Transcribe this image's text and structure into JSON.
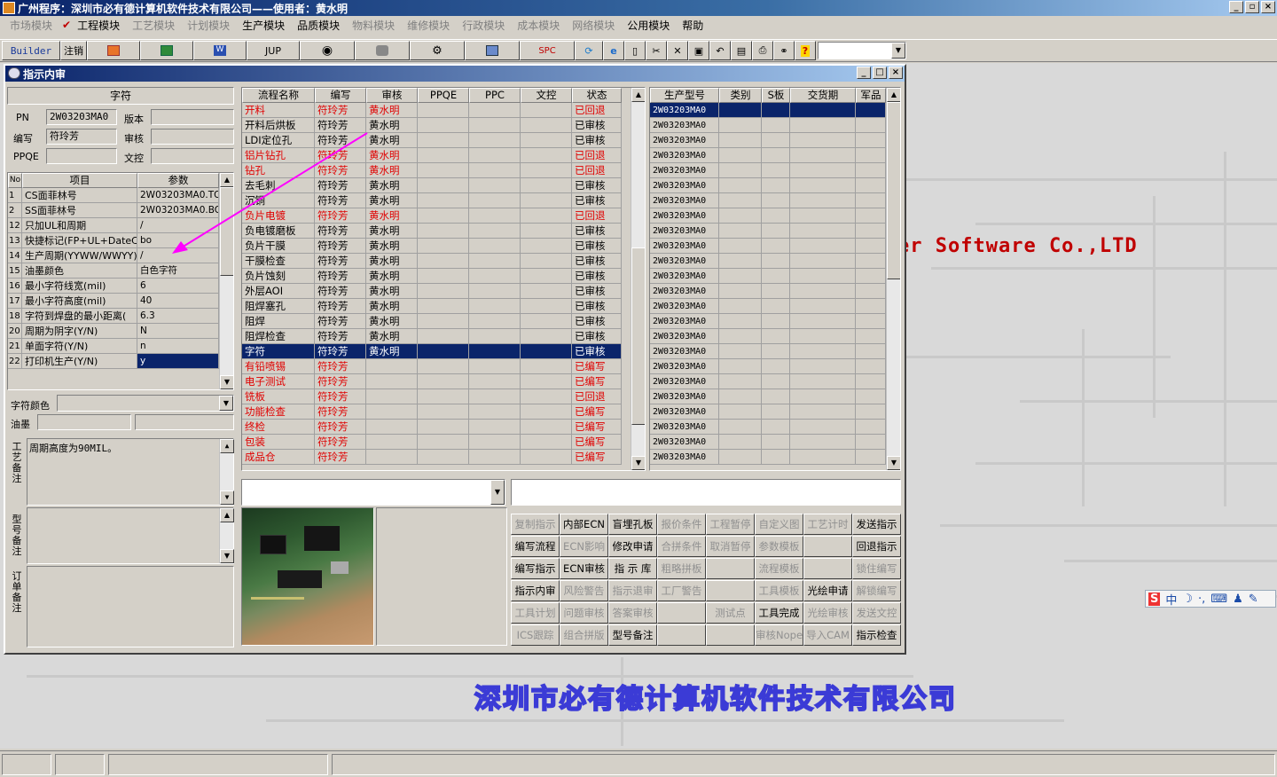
{
  "app": {
    "title": "广州程序：深圳市必有德计算机软件技术有限公司——使用者：黄水明",
    "menus": [
      {
        "label": "市场模块",
        "enabled": false
      },
      {
        "label": "工程模块",
        "enabled": true
      },
      {
        "label": "工艺模块",
        "enabled": false
      },
      {
        "label": "计划模块",
        "enabled": false
      },
      {
        "label": "生产模块",
        "enabled": true
      },
      {
        "label": "品质模块",
        "enabled": true
      },
      {
        "label": "物料模块",
        "enabled": false
      },
      {
        "label": "维修模块",
        "enabled": false
      },
      {
        "label": "行政模块",
        "enabled": false
      },
      {
        "label": "成本模块",
        "enabled": false
      },
      {
        "label": "网络模块",
        "enabled": false
      },
      {
        "label": "公用模块",
        "enabled": true
      },
      {
        "label": "帮助",
        "enabled": true
      }
    ],
    "toolbar": {
      "builder": "Builder",
      "logout": "注销",
      "jup": "JUP",
      "spc": "SPC"
    }
  },
  "desktop": {
    "software_text": "er Software Co.,LTD",
    "company_text": "深圳市必有德计算机软件技术有限公司"
  },
  "window": {
    "title": "指示内审",
    "left": {
      "heading": "字符",
      "pn_label": "PN",
      "pn_value": "2W03203MA0",
      "version_label": "版本",
      "version_value": "",
      "author_label": "编写",
      "author_value": "符玲芳",
      "review_label": "审核",
      "review_value": "",
      "ppqe_label": "PPQE",
      "ppqe_value": "",
      "doc_label": "文控",
      "doc_value": "",
      "param_headers": [
        "No",
        "项目",
        "参数"
      ],
      "params": [
        {
          "no": "1",
          "item": "CS面菲林号",
          "value": "2W03203MA0.TO"
        },
        {
          "no": "2",
          "item": "SS面菲林号",
          "value": "2W03203MA0.BO"
        },
        {
          "no": "12",
          "item": "只加UL和周期",
          "value": "/"
        },
        {
          "no": "13",
          "item": "快捷标记(FP+UL+DateCo",
          "value": "bo"
        },
        {
          "no": "14",
          "item": "生产周期(YYWW/WWYY)",
          "value": "/"
        },
        {
          "no": "15",
          "item": "油墨颜色",
          "value": "白色字符"
        },
        {
          "no": "16",
          "item": "最小字符线宽(mil)",
          "value": "6"
        },
        {
          "no": "17",
          "item": "最小字符高度(mil)",
          "value": "40"
        },
        {
          "no": "18",
          "item": "字符到焊盘的最小距离(",
          "value": "6.3"
        },
        {
          "no": "20",
          "item": "周期为阴字(Y/N)",
          "value": "N"
        },
        {
          "no": "21",
          "item": "单面字符(Y/N)",
          "value": "n"
        },
        {
          "no": "22",
          "item": "打印机生产(Y/N)",
          "value": "y"
        }
      ],
      "char_color_label": "字符颜色",
      "ink_label": "油墨",
      "process_note_label": "工艺备注",
      "process_note": "周期高度为90MIL。",
      "model_note_label": "型号备注",
      "order_note_label": "订单备注"
    },
    "process_headers": [
      "流程名称",
      "编写",
      "审核",
      "PPQE",
      "PPC",
      "文控",
      "状态"
    ],
    "process_rows": [
      {
        "name": "开料",
        "author": "符玲芳",
        "reviewer": "黄水明",
        "status": "已回退",
        "red": true
      },
      {
        "name": "开料后烘板",
        "author": "符玲芳",
        "reviewer": "黄水明",
        "status": "已审核",
        "red": false
      },
      {
        "name": "LDI定位孔",
        "author": "符玲芳",
        "reviewer": "黄水明",
        "status": "已审核",
        "red": false
      },
      {
        "name": "铝片钻孔",
        "author": "符玲芳",
        "reviewer": "黄水明",
        "status": "已回退",
        "red": true
      },
      {
        "name": "钻孔",
        "author": "符玲芳",
        "reviewer": "黄水明",
        "status": "已回退",
        "red": true
      },
      {
        "name": "去毛刺",
        "author": "符玲芳",
        "reviewer": "黄水明",
        "status": "已审核",
        "red": false
      },
      {
        "name": "沉铜",
        "author": "符玲芳",
        "reviewer": "黄水明",
        "status": "已审核",
        "red": false
      },
      {
        "name": "负片电镀",
        "author": "符玲芳",
        "reviewer": "黄水明",
        "status": "已回退",
        "red": true
      },
      {
        "name": "负电镀磨板",
        "author": "符玲芳",
        "reviewer": "黄水明",
        "status": "已审核",
        "red": false
      },
      {
        "name": "负片干膜",
        "author": "符玲芳",
        "reviewer": "黄水明",
        "status": "已审核",
        "red": false
      },
      {
        "name": "干膜检查",
        "author": "符玲芳",
        "reviewer": "黄水明",
        "status": "已审核",
        "red": false
      },
      {
        "name": "负片蚀刻",
        "author": "符玲芳",
        "reviewer": "黄水明",
        "status": "已审核",
        "red": false
      },
      {
        "name": "外层AOI",
        "author": "符玲芳",
        "reviewer": "黄水明",
        "status": "已审核",
        "red": false
      },
      {
        "name": "阻焊塞孔",
        "author": "符玲芳",
        "reviewer": "黄水明",
        "status": "已审核",
        "red": false
      },
      {
        "name": "阻焊",
        "author": "符玲芳",
        "reviewer": "黄水明",
        "status": "已审核",
        "red": false
      },
      {
        "name": "阻焊检查",
        "author": "符玲芳",
        "reviewer": "黄水明",
        "status": "已审核",
        "red": false
      },
      {
        "name": "字符",
        "author": "符玲芳",
        "reviewer": "黄水明",
        "status": "已审核",
        "red": false,
        "selected": true
      },
      {
        "name": "有铅喷锡",
        "author": "符玲芳",
        "reviewer": "",
        "status": "已编写",
        "red": true
      },
      {
        "name": "电子测试",
        "author": "符玲芳",
        "reviewer": "",
        "status": "已编写",
        "red": true
      },
      {
        "name": "铣板",
        "author": "符玲芳",
        "reviewer": "",
        "status": "已回退",
        "red": true
      },
      {
        "name": "功能检查",
        "author": "符玲芳",
        "reviewer": "",
        "status": "已编写",
        "red": true
      },
      {
        "name": "终检",
        "author": "符玲芳",
        "reviewer": "",
        "status": "已编写",
        "red": true
      },
      {
        "name": "包装",
        "author": "符玲芳",
        "reviewer": "",
        "status": "已编写",
        "red": true
      },
      {
        "name": "成品仓",
        "author": "符玲芳",
        "reviewer": "",
        "status": "已编写",
        "red": true
      }
    ],
    "model_headers": [
      "生产型号",
      "类别",
      "S板",
      "交货期",
      "军品"
    ],
    "model_value": "2W03203MA0",
    "model_row_count": 24,
    "buttons": [
      [
        "复制指示",
        "内部ECN",
        "盲埋孔板",
        "报价条件",
        "工程暂停",
        "自定义图",
        "工艺计时",
        "发送指示"
      ],
      [
        "编写流程",
        "ECN影响",
        "修改申请",
        "合拼条件",
        "取消暂停",
        "参数模板",
        "",
        "回退指示"
      ],
      [
        "编写指示",
        "ECN审核",
        "指 示 库",
        "粗略拼板",
        "",
        "流程模板",
        "",
        "锁住编写"
      ],
      [
        "指示内审",
        "风险警告",
        "指示退审",
        "工厂警告",
        "",
        "工具模板",
        "光绘申请",
        "解锁编写"
      ],
      [
        "工具计划",
        "问题审核",
        "答案审核",
        "",
        "测试点",
        "工具完成",
        "光绘审核",
        "发送文控"
      ],
      [
        "ICS跟踪",
        "组合拼版",
        "型号备注",
        "",
        "",
        "审核Nope",
        "导入CAM",
        "指示检查"
      ]
    ],
    "buttons_disabled": [
      [
        true,
        false,
        false,
        true,
        true,
        true,
        true,
        false
      ],
      [
        false,
        true,
        false,
        true,
        true,
        true,
        false,
        false
      ],
      [
        false,
        false,
        false,
        true,
        false,
        true,
        false,
        true
      ],
      [
        false,
        true,
        true,
        true,
        false,
        true,
        false,
        true
      ],
      [
        true,
        true,
        true,
        false,
        true,
        false,
        true,
        true
      ],
      [
        true,
        true,
        false,
        false,
        false,
        true,
        true,
        false
      ]
    ]
  }
}
